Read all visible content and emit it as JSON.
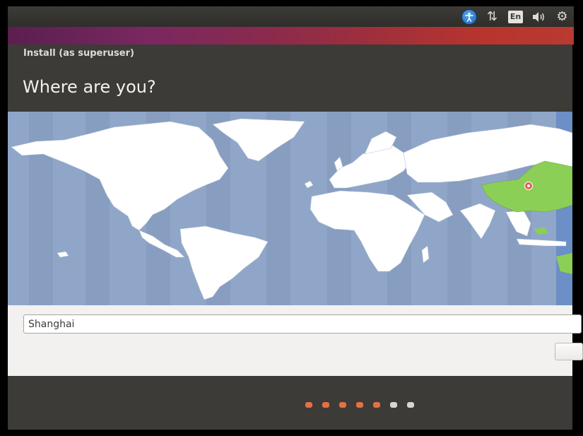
{
  "panel": {
    "indicators": [
      {
        "name": "accessibility-icon"
      },
      {
        "name": "network-icon",
        "glyph": "⇅"
      },
      {
        "name": "keyboard-layout-icon",
        "label": "En"
      },
      {
        "name": "volume-icon",
        "glyph": "🔊"
      },
      {
        "name": "settings-gear-icon",
        "glyph": "⚙"
      }
    ]
  },
  "window": {
    "title": "Install (as superuser)",
    "heading": "Where are you?"
  },
  "map": {
    "ocean_color": "#8fa6c9",
    "land_color": "#ffffff",
    "selected_region_color": "#8bcf56",
    "marker_color": "#e35d4f",
    "selected_city": "Shanghai"
  },
  "timezone": {
    "value": "Shanghai"
  },
  "progress": {
    "total_steps": 7,
    "completed_steps": 5,
    "done_color": "#e66f45",
    "todo_color": "#d9d6d0"
  }
}
